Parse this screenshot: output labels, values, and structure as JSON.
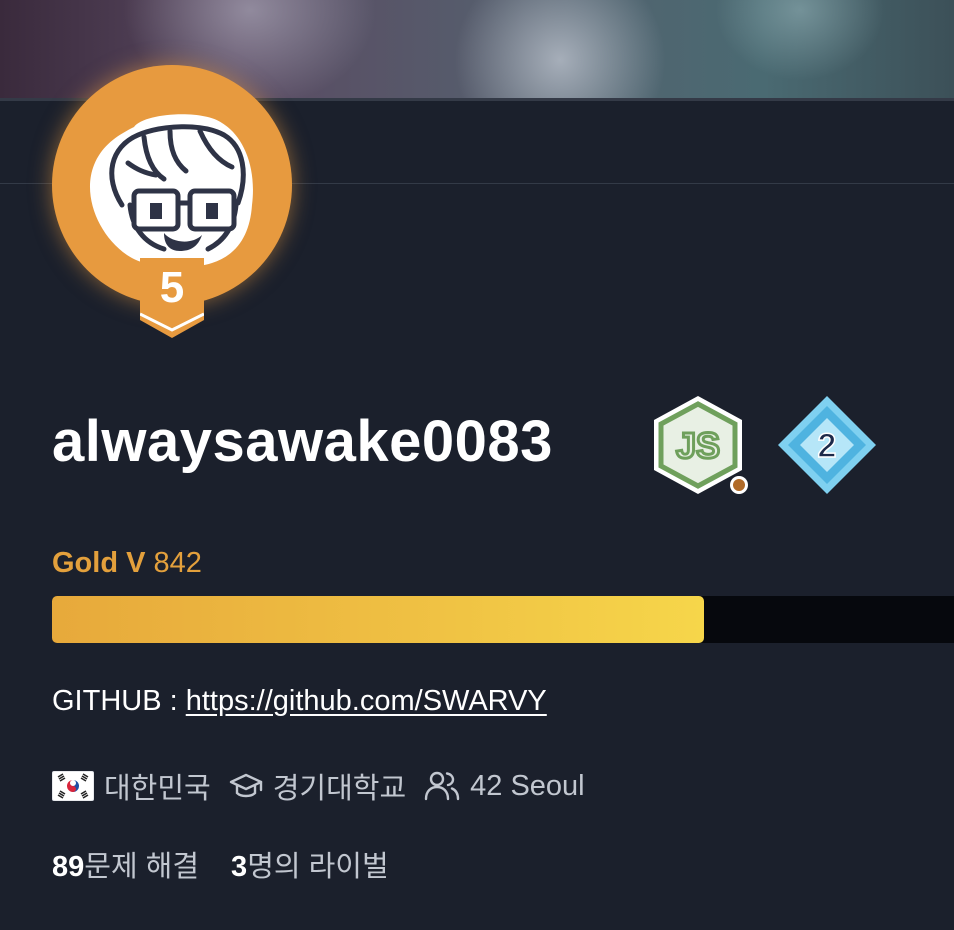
{
  "profile": {
    "tier_level": "5",
    "username": "alwaysawake0083",
    "rating": {
      "tier_name": "Gold V",
      "value": "842",
      "progress_fraction": 0.723,
      "color": "#e3a03c"
    },
    "badges": {
      "js_badge_text": "JS",
      "class_badge_text": "2"
    },
    "github": {
      "label": "GITHUB : ",
      "url": "https://github.com/SWARVY"
    },
    "meta": {
      "country": "대한민국",
      "school": "경기대학교",
      "organization": "42 Seoul"
    },
    "stats": {
      "solved_count": "89",
      "solved_label": "문제 해결",
      "rival_count": "3",
      "rival_label": "명의 라이벌"
    }
  }
}
